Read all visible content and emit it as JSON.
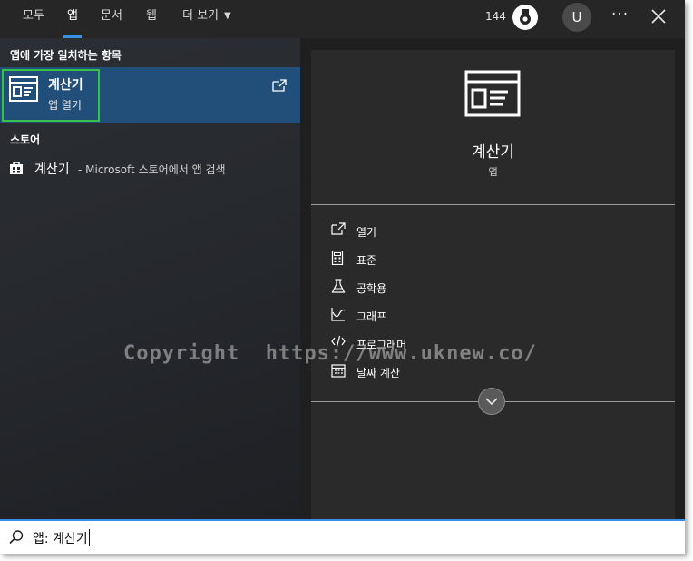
{
  "topbar": {
    "tabs": [
      {
        "label": "모두"
      },
      {
        "label": "앱"
      },
      {
        "label": "문서"
      },
      {
        "label": "웹"
      },
      {
        "label": "더 보기"
      }
    ],
    "active_tab": "앱",
    "points": "144",
    "avatar_letter": "U",
    "more_label": "···"
  },
  "left": {
    "best_match_header": "앱에 가장 일치하는 항목",
    "best_match": {
      "title": "계산기",
      "subtitle": "앱 열기",
      "icon": "calculator-icon"
    },
    "store_header": "스토어",
    "store_result": {
      "name": "계산기",
      "desc": "- Microsoft 스토어에서 앱 검색",
      "icon": "store-bag-icon"
    }
  },
  "right": {
    "app_name": "계산기",
    "app_kind": "앱",
    "actions": [
      {
        "label": "열기",
        "icon": "open-icon"
      },
      {
        "label": "표준",
        "icon": "standard-calc-icon"
      },
      {
        "label": "공학용",
        "icon": "flask-icon"
      },
      {
        "label": "그래프",
        "icon": "graph-icon"
      },
      {
        "label": "프로그래머",
        "icon": "code-icon"
      },
      {
        "label": "날짜 계산",
        "icon": "calendar-icon"
      }
    ]
  },
  "watermark": "Copyright  https://www.uknew.co/",
  "search": {
    "value": "앱: 계산기"
  },
  "colors": {
    "accent": "#3a8ee6",
    "selected_row": "#214f79",
    "highlight_outline": "#35c24b"
  }
}
